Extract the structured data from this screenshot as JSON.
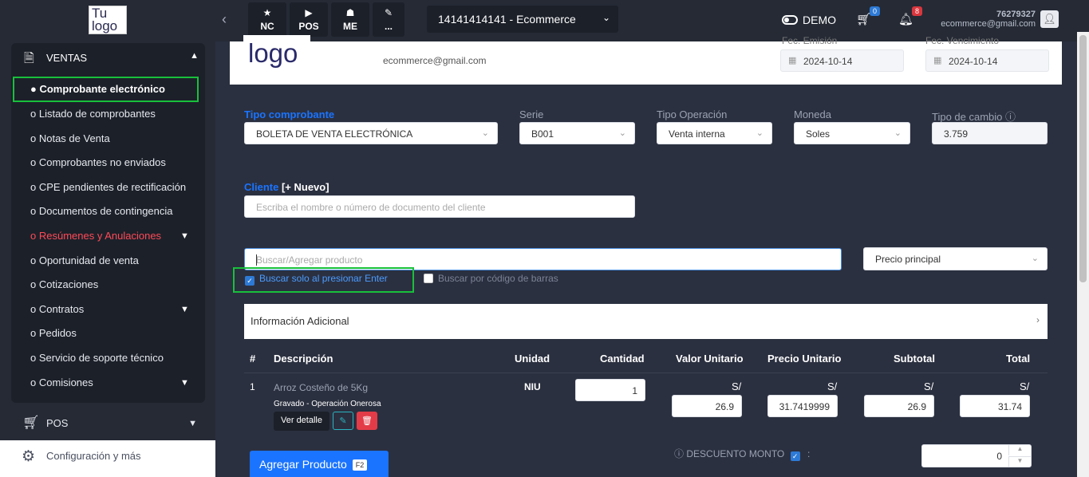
{
  "topbar": {
    "logo_line1": "Tu",
    "logo_line2": "logo",
    "buttons": [
      {
        "label": "NC",
        "icon": "star-icon"
      },
      {
        "label": "POS",
        "icon": "play-icon"
      },
      {
        "label": "ME",
        "icon": "users-icon"
      },
      {
        "label": "...",
        "icon": "pencil-icon"
      }
    ],
    "company_select": "14141414141 - Ecommerce",
    "demo_label": "DEMO",
    "cart_count": "0",
    "notif_count": "8",
    "user_id": "76279327",
    "user_email": "ecommerce@gmail.com"
  },
  "sidebar": {
    "section_title": "VENTAS",
    "items": [
      {
        "label": "● Comprobante electrónico",
        "active": true
      },
      {
        "label": "o Listado de comprobantes"
      },
      {
        "label": "o Notas de Venta"
      },
      {
        "label": "o Comprobantes no enviados"
      },
      {
        "label": "o CPE pendientes de rectificación"
      },
      {
        "label": "o Documentos de contingencia"
      },
      {
        "label": "o Resúmenes y Anulaciones",
        "color": "#ff4a57"
      },
      {
        "label": "o Oportunidad de venta"
      },
      {
        "label": "o Cotizaciones"
      },
      {
        "label": "o Contratos"
      },
      {
        "label": "o Pedidos"
      },
      {
        "label": "o Servicio de soporte técnico"
      },
      {
        "label": "o Comisiones"
      }
    ],
    "pos_label": "POS",
    "config_label": "Configuración y más"
  },
  "header": {
    "logo_text": "logo",
    "email": "ecommerce@gmail.com",
    "fec_emision_label": "Fec. Emisión",
    "fec_emision": "2024-10-14",
    "fec_vencimiento_label": "Fec. Vencimiento",
    "fec_vencimiento": "2024-10-14"
  },
  "form": {
    "tipo_comprobante_label": "Tipo comprobante",
    "tipo_comprobante": "BOLETA DE VENTA ELECTRÓNICA",
    "serie_label": "Serie",
    "serie": "B001",
    "tipo_operacion_label": "Tipo Operación",
    "tipo_operacion": "Venta interna",
    "moneda_label": "Moneda",
    "moneda": "Soles",
    "tipo_cambio_label": "Tipo de cambio",
    "tipo_cambio": "3.759",
    "cliente_label": "Cliente",
    "nuevo_label": "[+ Nuevo]",
    "cliente_placeholder": "Escriba el nombre o número de documento del cliente",
    "buscar_placeholder": "Buscar/Agregar producto",
    "precio_select": "Precio principal",
    "check_enter_label": "Buscar solo al presionar Enter",
    "check_barcode_label": "Buscar por código de barras",
    "info_adicional": "Información Adicional"
  },
  "table": {
    "headers": [
      "#",
      "Descripción",
      "Unidad",
      "Cantidad",
      "Valor Unitario",
      "Precio Unitario",
      "Subtotal",
      "Total"
    ],
    "rows": [
      {
        "index": "1",
        "descripcion": "Arroz Costeño de 5Kg",
        "afectacion": "Gravado - Operación Onerosa",
        "ver_detalle": "Ver detalle",
        "unidad": "NIU",
        "cantidad": "1",
        "currency": "S/",
        "valor_unitario": "26.9",
        "precio_unitario": "31.7419999",
        "subtotal": "26.9",
        "total": "31.74"
      }
    ]
  },
  "footer": {
    "add_product_label": "Agregar Producto",
    "add_product_key": "F2",
    "descuento_label": "DESCUENTO MONTO",
    "descuento_colon": ":",
    "descuento_value": "0"
  },
  "colors": {
    "accent": "#1a74ff",
    "highlight": "#18c03b",
    "sidebar_bg": "#252a35",
    "content_bg": "#2b3040"
  }
}
